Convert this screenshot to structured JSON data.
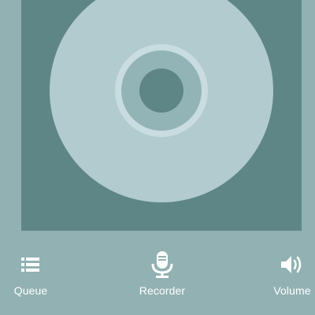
{
  "album_art": {
    "icon": "disc-icon",
    "background_color": "#5f8687",
    "disc_color": "#b1cbcf"
  },
  "controls": {
    "queue": {
      "label": "Queue",
      "icon": "queue-list-icon"
    },
    "recorder": {
      "label": "Recorder",
      "icon": "microphone-icon"
    },
    "volume": {
      "label": "Volume",
      "icon": "speaker-volume-icon"
    }
  },
  "colors": {
    "screen_background": "#92b1b2",
    "label_text": "#ffffff",
    "icon": "#ffffff"
  }
}
